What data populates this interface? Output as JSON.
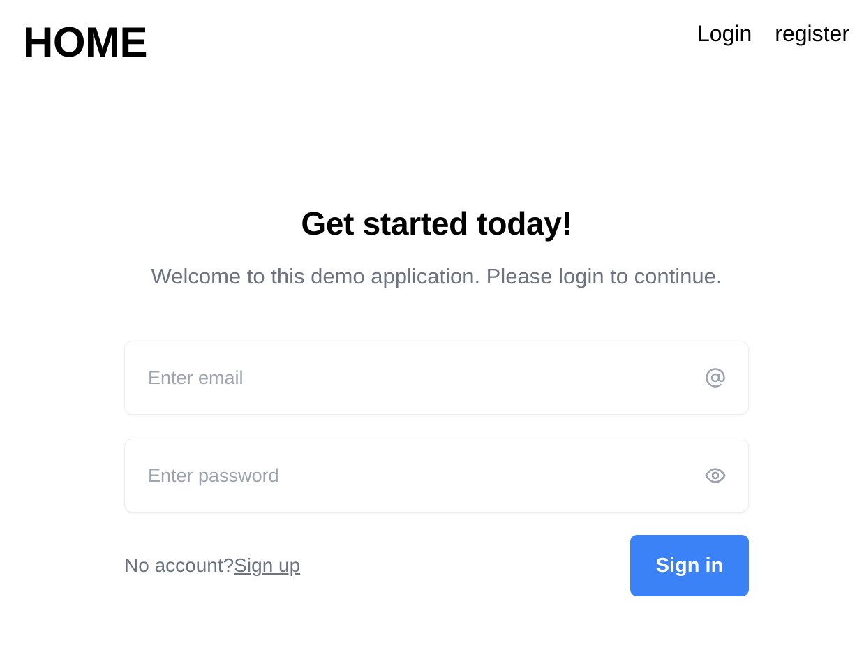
{
  "header": {
    "brand": "HOME",
    "nav": {
      "login_label": "Login",
      "register_label": "register"
    }
  },
  "form": {
    "title": "Get started today!",
    "subtitle": "Welcome to this demo application. Please login to continue.",
    "email": {
      "value": "",
      "placeholder": "Enter email",
      "icon": "at-icon"
    },
    "password": {
      "value": "",
      "placeholder": "Enter password",
      "icon": "eye-icon"
    },
    "no_account_text": "No account?",
    "signup_label": "Sign up",
    "signin_label": "Sign in"
  },
  "colors": {
    "accent": "#3b82f6",
    "muted_text": "#6b7280",
    "placeholder": "#9ca3af"
  }
}
